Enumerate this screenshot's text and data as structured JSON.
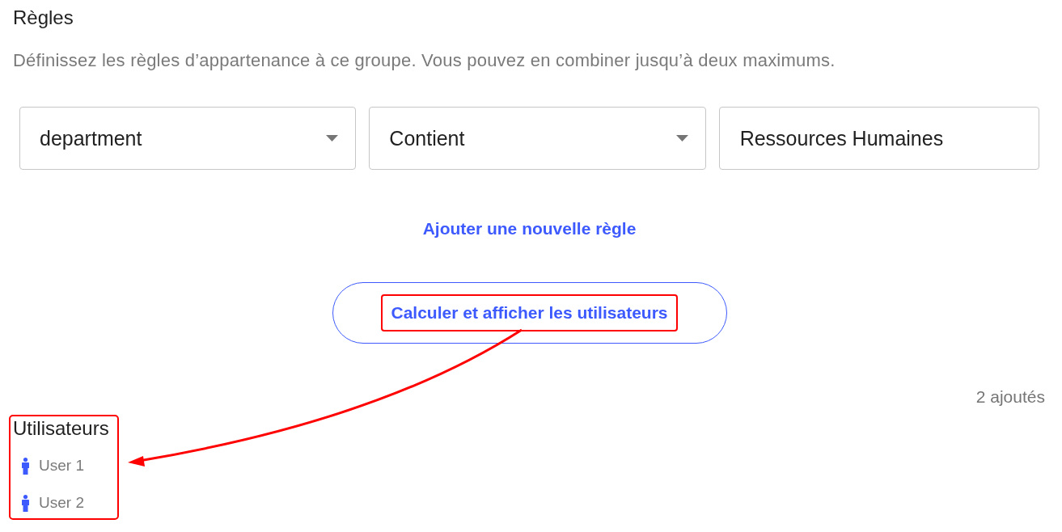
{
  "header": {
    "title": "Règles",
    "description": "Définissez les règles d’appartenance à ce groupe. Vous pouvez en combiner jusqu’à deux maximums."
  },
  "rule": [
    {
      "kind": "select",
      "value": "department"
    },
    {
      "kind": "select",
      "value": "Contient"
    },
    {
      "kind": "input",
      "value": "Ressources Humaines"
    }
  ],
  "add_rule_link": "Ajouter une nouvelle règle",
  "compute_button": {
    "label": "Calculer et afficher les utilisateurs",
    "highlighted": true
  },
  "added_count": "2 ajoutés",
  "users": {
    "title": "Utilisateurs",
    "highlighted": true,
    "items": [
      "User 1",
      "User 2"
    ]
  },
  "annotation_arrow": true
}
